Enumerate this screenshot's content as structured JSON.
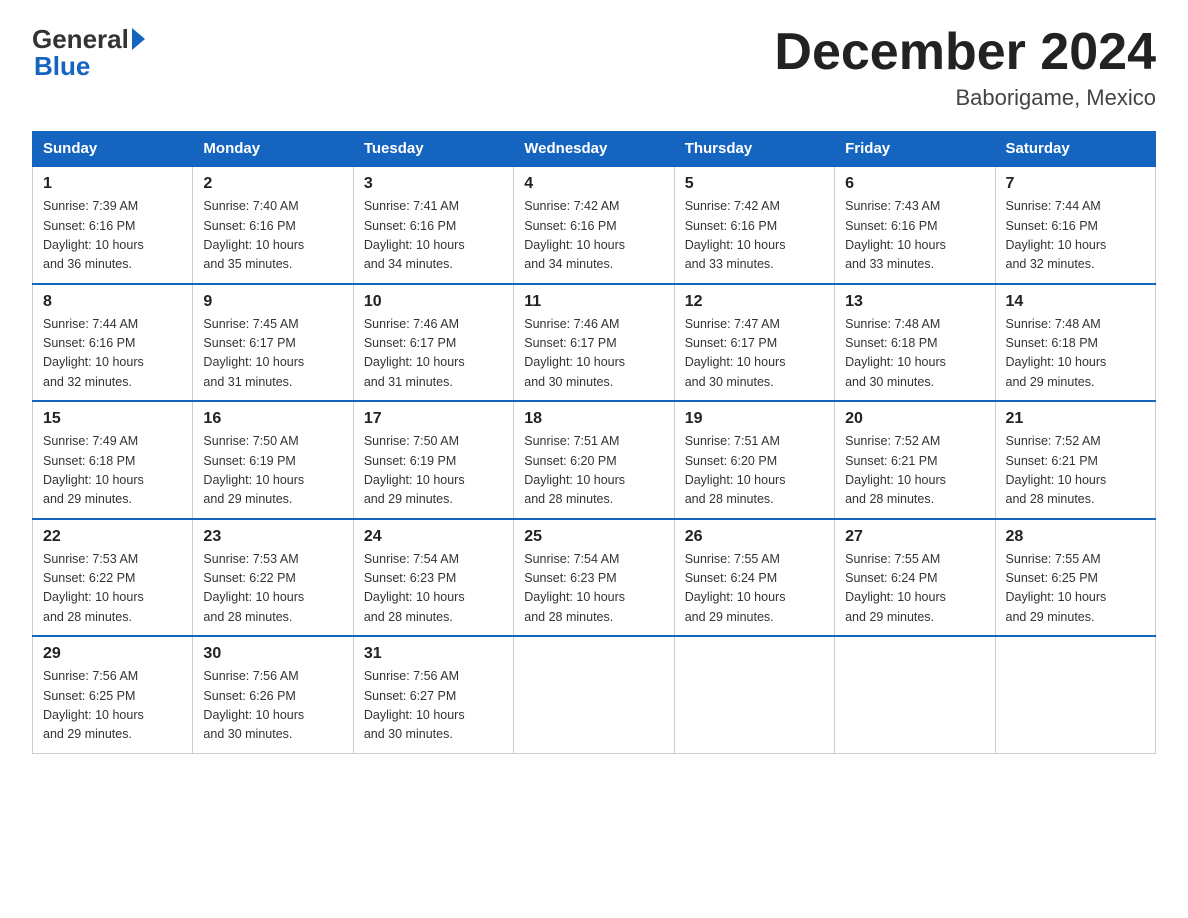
{
  "logo": {
    "general": "General",
    "blue": "Blue"
  },
  "title": "December 2024",
  "subtitle": "Baborigame, Mexico",
  "days_of_week": [
    "Sunday",
    "Monday",
    "Tuesday",
    "Wednesday",
    "Thursday",
    "Friday",
    "Saturday"
  ],
  "weeks": [
    [
      {
        "day": "1",
        "sunrise": "7:39 AM",
        "sunset": "6:16 PM",
        "daylight": "10 hours and 36 minutes."
      },
      {
        "day": "2",
        "sunrise": "7:40 AM",
        "sunset": "6:16 PM",
        "daylight": "10 hours and 35 minutes."
      },
      {
        "day": "3",
        "sunrise": "7:41 AM",
        "sunset": "6:16 PM",
        "daylight": "10 hours and 34 minutes."
      },
      {
        "day": "4",
        "sunrise": "7:42 AM",
        "sunset": "6:16 PM",
        "daylight": "10 hours and 34 minutes."
      },
      {
        "day": "5",
        "sunrise": "7:42 AM",
        "sunset": "6:16 PM",
        "daylight": "10 hours and 33 minutes."
      },
      {
        "day": "6",
        "sunrise": "7:43 AM",
        "sunset": "6:16 PM",
        "daylight": "10 hours and 33 minutes."
      },
      {
        "day": "7",
        "sunrise": "7:44 AM",
        "sunset": "6:16 PM",
        "daylight": "10 hours and 32 minutes."
      }
    ],
    [
      {
        "day": "8",
        "sunrise": "7:44 AM",
        "sunset": "6:16 PM",
        "daylight": "10 hours and 32 minutes."
      },
      {
        "day": "9",
        "sunrise": "7:45 AM",
        "sunset": "6:17 PM",
        "daylight": "10 hours and 31 minutes."
      },
      {
        "day": "10",
        "sunrise": "7:46 AM",
        "sunset": "6:17 PM",
        "daylight": "10 hours and 31 minutes."
      },
      {
        "day": "11",
        "sunrise": "7:46 AM",
        "sunset": "6:17 PM",
        "daylight": "10 hours and 30 minutes."
      },
      {
        "day": "12",
        "sunrise": "7:47 AM",
        "sunset": "6:17 PM",
        "daylight": "10 hours and 30 minutes."
      },
      {
        "day": "13",
        "sunrise": "7:48 AM",
        "sunset": "6:18 PM",
        "daylight": "10 hours and 30 minutes."
      },
      {
        "day": "14",
        "sunrise": "7:48 AM",
        "sunset": "6:18 PM",
        "daylight": "10 hours and 29 minutes."
      }
    ],
    [
      {
        "day": "15",
        "sunrise": "7:49 AM",
        "sunset": "6:18 PM",
        "daylight": "10 hours and 29 minutes."
      },
      {
        "day": "16",
        "sunrise": "7:50 AM",
        "sunset": "6:19 PM",
        "daylight": "10 hours and 29 minutes."
      },
      {
        "day": "17",
        "sunrise": "7:50 AM",
        "sunset": "6:19 PM",
        "daylight": "10 hours and 29 minutes."
      },
      {
        "day": "18",
        "sunrise": "7:51 AM",
        "sunset": "6:20 PM",
        "daylight": "10 hours and 28 minutes."
      },
      {
        "day": "19",
        "sunrise": "7:51 AM",
        "sunset": "6:20 PM",
        "daylight": "10 hours and 28 minutes."
      },
      {
        "day": "20",
        "sunrise": "7:52 AM",
        "sunset": "6:21 PM",
        "daylight": "10 hours and 28 minutes."
      },
      {
        "day": "21",
        "sunrise": "7:52 AM",
        "sunset": "6:21 PM",
        "daylight": "10 hours and 28 minutes."
      }
    ],
    [
      {
        "day": "22",
        "sunrise": "7:53 AM",
        "sunset": "6:22 PM",
        "daylight": "10 hours and 28 minutes."
      },
      {
        "day": "23",
        "sunrise": "7:53 AM",
        "sunset": "6:22 PM",
        "daylight": "10 hours and 28 minutes."
      },
      {
        "day": "24",
        "sunrise": "7:54 AM",
        "sunset": "6:23 PM",
        "daylight": "10 hours and 28 minutes."
      },
      {
        "day": "25",
        "sunrise": "7:54 AM",
        "sunset": "6:23 PM",
        "daylight": "10 hours and 28 minutes."
      },
      {
        "day": "26",
        "sunrise": "7:55 AM",
        "sunset": "6:24 PM",
        "daylight": "10 hours and 29 minutes."
      },
      {
        "day": "27",
        "sunrise": "7:55 AM",
        "sunset": "6:24 PM",
        "daylight": "10 hours and 29 minutes."
      },
      {
        "day": "28",
        "sunrise": "7:55 AM",
        "sunset": "6:25 PM",
        "daylight": "10 hours and 29 minutes."
      }
    ],
    [
      {
        "day": "29",
        "sunrise": "7:56 AM",
        "sunset": "6:25 PM",
        "daylight": "10 hours and 29 minutes."
      },
      {
        "day": "30",
        "sunrise": "7:56 AM",
        "sunset": "6:26 PM",
        "daylight": "10 hours and 30 minutes."
      },
      {
        "day": "31",
        "sunrise": "7:56 AM",
        "sunset": "6:27 PM",
        "daylight": "10 hours and 30 minutes."
      },
      null,
      null,
      null,
      null
    ]
  ],
  "labels": {
    "sunrise": "Sunrise:",
    "sunset": "Sunset:",
    "daylight": "Daylight:"
  }
}
